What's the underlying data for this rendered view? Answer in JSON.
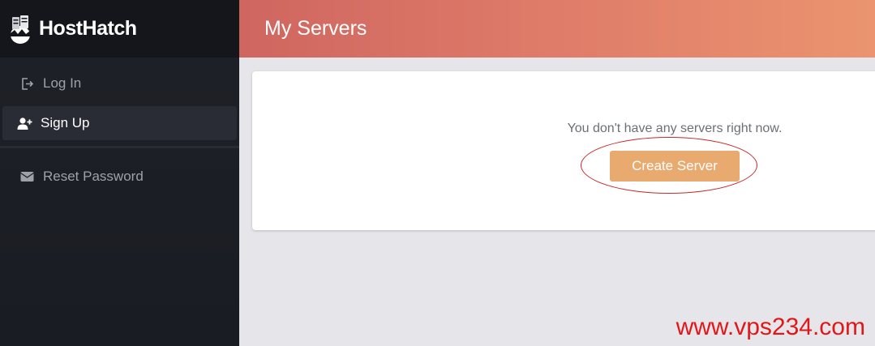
{
  "brand": {
    "name": "HostHatch",
    "logo_icon": "hatching-egg-server-logo"
  },
  "sidebar": {
    "items": [
      {
        "label": "Log In",
        "icon": "login-icon",
        "active": false
      },
      {
        "label": "Sign Up",
        "icon": "user-plus-icon",
        "active": true
      },
      {
        "label": "Reset Password",
        "icon": "envelope-icon",
        "active": false
      }
    ]
  },
  "header": {
    "title": "My Servers"
  },
  "main": {
    "empty_message": "You don't have any servers right now.",
    "create_button_label": "Create Server"
  },
  "watermark": "www.vps234.com",
  "colors": {
    "accent_button": "#e8aa6e",
    "header_gradient_start": "#cf6660",
    "header_gradient_end": "#eb946f",
    "sidebar_bg": "#1f2128",
    "annotation_circle": "#c8282a",
    "watermark": "#e0181a"
  }
}
